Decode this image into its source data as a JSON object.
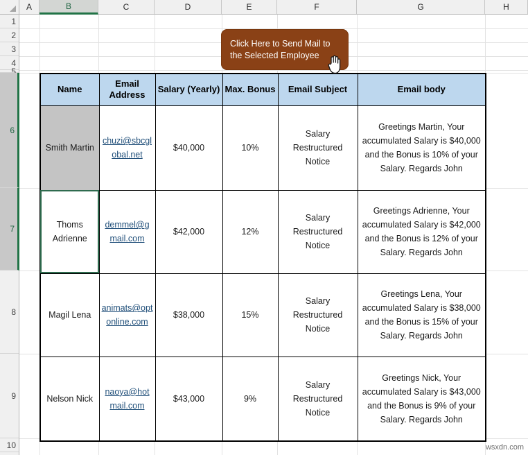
{
  "app": {
    "type": "spreadsheet",
    "watermark": "wsxdn.com"
  },
  "colors": {
    "header_fill": "#BDD7EE",
    "button_fill": "#8A4116",
    "selected_cell_fill": "#C4C4C4",
    "active_outline": "#2E6B4E",
    "hyperlink": "#1F4E79"
  },
  "columns": [
    {
      "label": "A",
      "active": false
    },
    {
      "label": "B",
      "active": true
    },
    {
      "label": "C",
      "active": false
    },
    {
      "label": "D",
      "active": false
    },
    {
      "label": "E",
      "active": false
    },
    {
      "label": "F",
      "active": false
    },
    {
      "label": "G",
      "active": false
    },
    {
      "label": "H",
      "active": false
    }
  ],
  "rows": [
    {
      "label": "1",
      "active": false
    },
    {
      "label": "2",
      "active": false
    },
    {
      "label": "3",
      "active": false
    },
    {
      "label": "4",
      "active": false
    },
    {
      "label": "5",
      "active": false
    },
    {
      "label": "6",
      "active": true
    },
    {
      "label": "7",
      "active": true
    },
    {
      "label": "8",
      "active": false
    },
    {
      "label": "9",
      "active": false
    },
    {
      "label": "10",
      "active": false
    }
  ],
  "button": {
    "label": "Click Here to Send Mail to the Selected Employee"
  },
  "cursor": {
    "icon": "hand-pointer-cursor"
  },
  "table": {
    "headers": [
      "Name",
      "Email Address",
      "Salary (Yearly)",
      "Max. Bonus",
      "Email Subject",
      "Email body"
    ],
    "rows": [
      {
        "name": "Smith Martin",
        "email": "chuzi@sbcglobal.net",
        "salary": "$40,000",
        "bonus": "10%",
        "subject": "Salary Restructured Notice",
        "body": "Greetings Martin, Your accumulated Salary is $40,000 and the Bonus is 10% of your Salary. Regards John",
        "name_fill": "gray",
        "active": false
      },
      {
        "name": "Thoms Adrienne",
        "email": "demmel@gmail.com",
        "salary": "$42,000",
        "bonus": "12%",
        "subject": "Salary Restructured Notice",
        "body": "Greetings Adrienne, Your accumulated Salary is $42,000 and the Bonus is 12% of your Salary. Regards John",
        "name_fill": "none",
        "active": true
      },
      {
        "name": "Magil Lena",
        "email": "animats@optonline.com",
        "salary": "$38,000",
        "bonus": "15%",
        "subject": "Salary Restructured Notice",
        "body": "Greetings Lena, Your accumulated Salary is $38,000 and the Bonus is 15% of your Salary. Regards John",
        "name_fill": "none",
        "active": false
      },
      {
        "name": "Nelson Nick",
        "email": "naoya@hotmail.com",
        "salary": "$43,000",
        "bonus": "9%",
        "subject": "Salary Restructured Notice",
        "body": "Greetings Nick, Your accumulated Salary is $43,000 and the Bonus is 9% of your Salary. Regards John",
        "name_fill": "none",
        "active": false
      }
    ]
  }
}
